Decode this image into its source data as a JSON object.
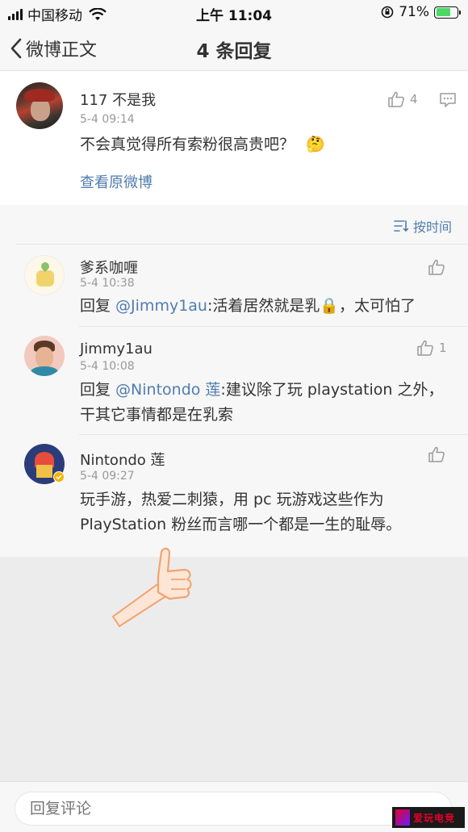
{
  "status_bar": {
    "carrier": "中国移动",
    "time": "上午 11:04",
    "battery": "71%"
  },
  "nav": {
    "back_label": "微博正文",
    "title": "4 条回复"
  },
  "main_comment": {
    "username": "117 不是我",
    "time": "5-4 09:14",
    "text": "不会真觉得所有索粉很高贵吧？",
    "emoji": "🤔",
    "like_count": "4",
    "view_original": "查看原微博"
  },
  "sort_label": "按时间",
  "replies": [
    {
      "username": "爹系咖喱",
      "time": "5-4 10:38",
      "prefix": "回复 ",
      "mention": "@Jimmy1au",
      "text": ":活着居然就是乳🔒，太可怕了",
      "like_count": ""
    },
    {
      "username": "Jimmy1au",
      "time": "5-4 10:08",
      "prefix": "回复 ",
      "mention": "@Nintondo 莲",
      "text": ":建议除了玩 playstation 之外，",
      "text2": "干其它事情都是在乳索",
      "like_count": "1"
    },
    {
      "username": "Nintondo 莲",
      "time": "5-4 09:27",
      "text": "玩手游，热爱二刺猿，用 pc 玩游戏这些作为",
      "text2": "PlayStation 粉丝而言哪一个都是一生的耻辱。",
      "like_count": ""
    }
  ],
  "reply_input": {
    "placeholder": "回复评论"
  },
  "watermark": "爱玩电竞"
}
